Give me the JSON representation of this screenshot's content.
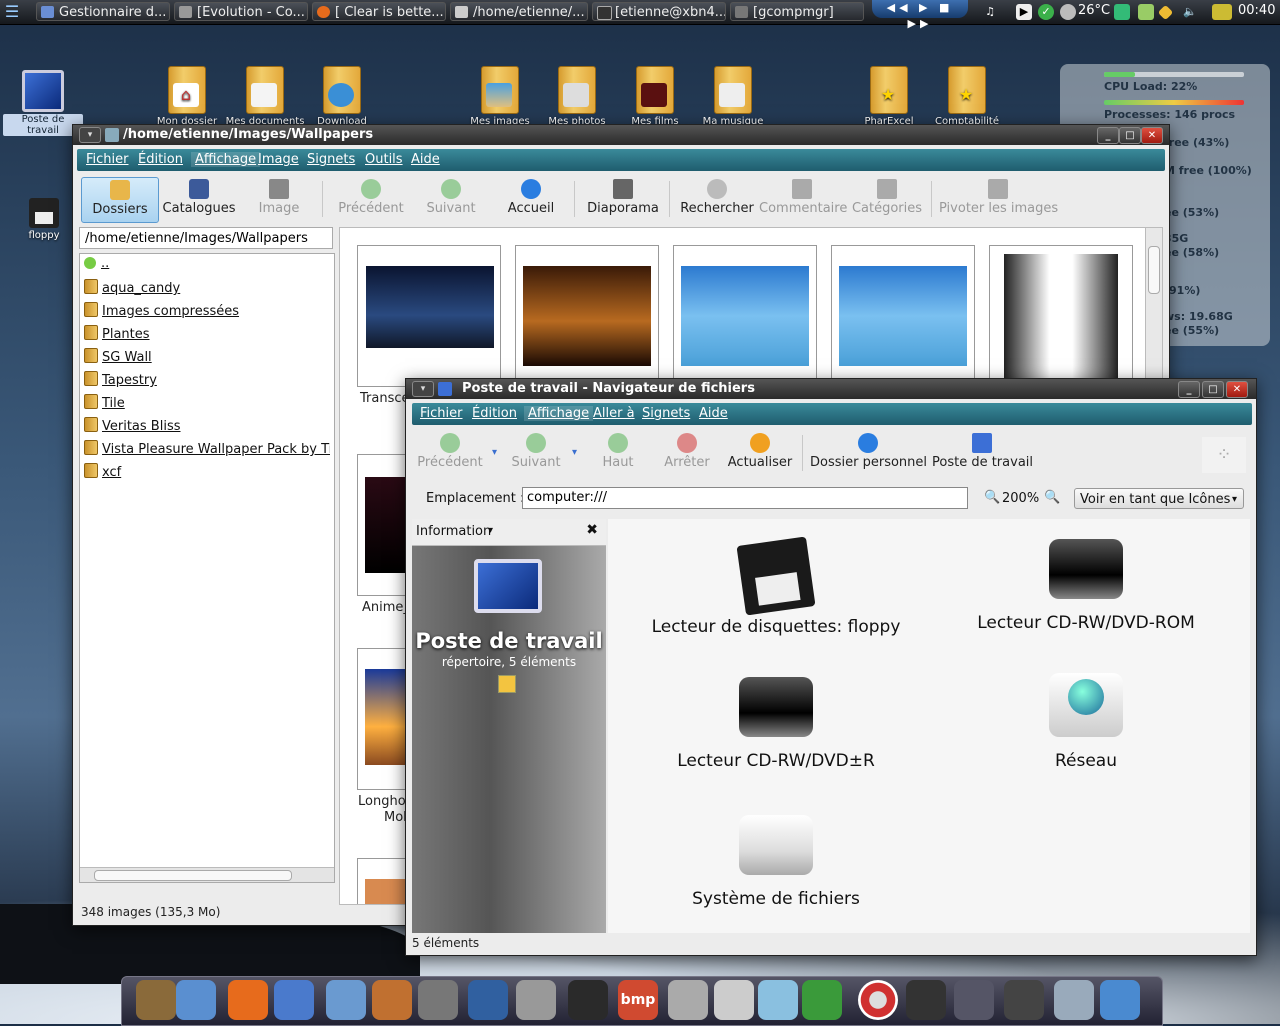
{
  "top_panel": {
    "tasks": [
      {
        "label": "Gestionnaire d...",
        "icon": "gnome-icon"
      },
      {
        "label": "[Evolution - Co...",
        "icon": "evolution-icon"
      },
      {
        "label": "[ Clear is bette...",
        "icon": "firefox-icon"
      },
      {
        "label": "/home/etienne/...",
        "icon": "folder-icon"
      },
      {
        "label": "[etienne@xbn4...",
        "icon": "terminal-icon"
      },
      {
        "label": "[gcompmgr]",
        "icon": "window-icon"
      }
    ],
    "temperature": "26°C",
    "clock": "00:40"
  },
  "desktop_icons": [
    {
      "label": "Poste de travail",
      "icon": "computer-icon",
      "selected": true
    },
    {
      "label": "floppy",
      "icon": "floppy-icon"
    },
    {
      "label": "Mon dossier",
      "icon": "home-folder-icon"
    },
    {
      "label": "Mes documents",
      "icon": "documents-folder-icon"
    },
    {
      "label": "Download",
      "icon": "download-folder-icon"
    },
    {
      "label": "Mes images",
      "icon": "images-folder-icon"
    },
    {
      "label": "Mes photos",
      "icon": "photos-folder-icon"
    },
    {
      "label": "Mes films",
      "icon": "films-folder-icon"
    },
    {
      "label": "Ma musique",
      "icon": "music-folder-icon"
    },
    {
      "label": "PharExcel",
      "icon": "star-folder-icon"
    },
    {
      "label": "Comptabilité",
      "icon": "star-folder-icon"
    }
  ],
  "conky": {
    "cpu": "CPU Load: 22%",
    "processes": "Processes: 146 procs",
    "cpu_load": 0.22,
    "lines": [
      "free (43%)",
      "M free (100%)",
      "ee (53%)",
      "35G",
      "ee (58%)",
      "(91%)",
      "ws: 19.68G",
      "ee (55%)"
    ]
  },
  "gthumb": {
    "title": "/home/etienne/Images/Wallpapers",
    "menu": [
      "Fichier",
      "Édition",
      "Affichage",
      "Image",
      "Signets",
      "Outils",
      "Aide"
    ],
    "toolbar": [
      {
        "label": "Dossiers",
        "icon": "folder-open-icon",
        "state": "selected"
      },
      {
        "label": "Catalogues",
        "icon": "book-icon",
        "state": "normal"
      },
      {
        "label": "Image",
        "icon": "image-icon",
        "state": "disabled"
      },
      {
        "label": "Précédent",
        "icon": "previous-icon",
        "state": "disabled"
      },
      {
        "label": "Suivant",
        "icon": "next-icon",
        "state": "disabled"
      },
      {
        "label": "Accueil",
        "icon": "home-icon",
        "state": "normal"
      },
      {
        "label": "Diaporama",
        "icon": "slideshow-icon",
        "state": "normal"
      },
      {
        "label": "Rechercher",
        "icon": "search-icon",
        "state": "normal"
      },
      {
        "label": "Commentaire",
        "icon": "comment-icon",
        "state": "disabled"
      },
      {
        "label": "Catégories",
        "icon": "categories-icon",
        "state": "disabled"
      },
      {
        "label": "Pivoter les images",
        "icon": "rotate-icon",
        "state": "disabled"
      }
    ],
    "location": "/home/etienne/Images/Wallpapers",
    "folders": [
      "..",
      "aqua_candy",
      "Images compressées",
      "Plantes",
      "SG Wall",
      "Tapestry",
      "Tile",
      "Veritas Bliss",
      "Vista Pleasure Wallpaper Pack by Tinku",
      "xcf"
    ],
    "thumbnails": [
      "Transce",
      "",
      "",
      "",
      "",
      "Anime_",
      "Longhor",
      "Moh"
    ],
    "status": "348 images (135,3 Mo)"
  },
  "nautilus": {
    "title": "Poste de travail - Navigateur de fichiers",
    "menu": [
      "Fichier",
      "Édition",
      "Affichage",
      "Aller à",
      "Signets",
      "Aide"
    ],
    "toolbar": [
      {
        "label": "Précédent",
        "icon": "back-icon",
        "state": "disabled"
      },
      {
        "label": "Suivant",
        "icon": "forward-icon",
        "state": "disabled"
      },
      {
        "label": "Haut",
        "icon": "up-icon",
        "state": "disabled"
      },
      {
        "label": "Arrêter",
        "icon": "stop-icon",
        "state": "disabled"
      },
      {
        "label": "Actualiser",
        "icon": "reload-icon",
        "state": "normal"
      },
      {
        "label": "Dossier personnel",
        "icon": "home-icon",
        "state": "normal"
      },
      {
        "label": "Poste de travail",
        "icon": "computer-icon",
        "state": "normal"
      }
    ],
    "location_label": "Emplacement :",
    "location_value": "computer:///",
    "zoom": "200%",
    "view_mode": "Voir en tant que Icônes",
    "sidebar_mode": "Information",
    "info_title": "Poste de travail",
    "info_subtitle": "répertoire, 5 éléments",
    "drives": [
      {
        "label": "Lecteur de disquettes: floppy",
        "icon": "floppy-drive-icon"
      },
      {
        "label": "Lecteur CD-RW/DVD-ROM",
        "icon": "cdrom-drive-icon"
      },
      {
        "label": "Lecteur CD-RW/DVD±R",
        "icon": "dvd-drive-icon"
      },
      {
        "label": "Réseau",
        "icon": "network-drive-icon"
      },
      {
        "label": "Système de fichiers",
        "icon": "filesystem-drive-icon"
      }
    ],
    "status": "5 éléments"
  },
  "dock": {
    "items": [
      "finder-icon",
      "pen-icon",
      "firefox-icon",
      "network-icon",
      "photo-icon",
      "gallery-icon",
      "gimp-icon",
      "inkscape-icon",
      "camera-icon",
      "eye-icon",
      "bmp-icon",
      "cd-icon",
      "calculator-icon",
      "notes-icon",
      "spreadsheet-icon",
      "lifebuoy-icon",
      "terminal-icon",
      "monitor-icon",
      "speedometer-icon",
      "document-icon",
      "mail-icon"
    ],
    "bmp_label": "bmp"
  }
}
